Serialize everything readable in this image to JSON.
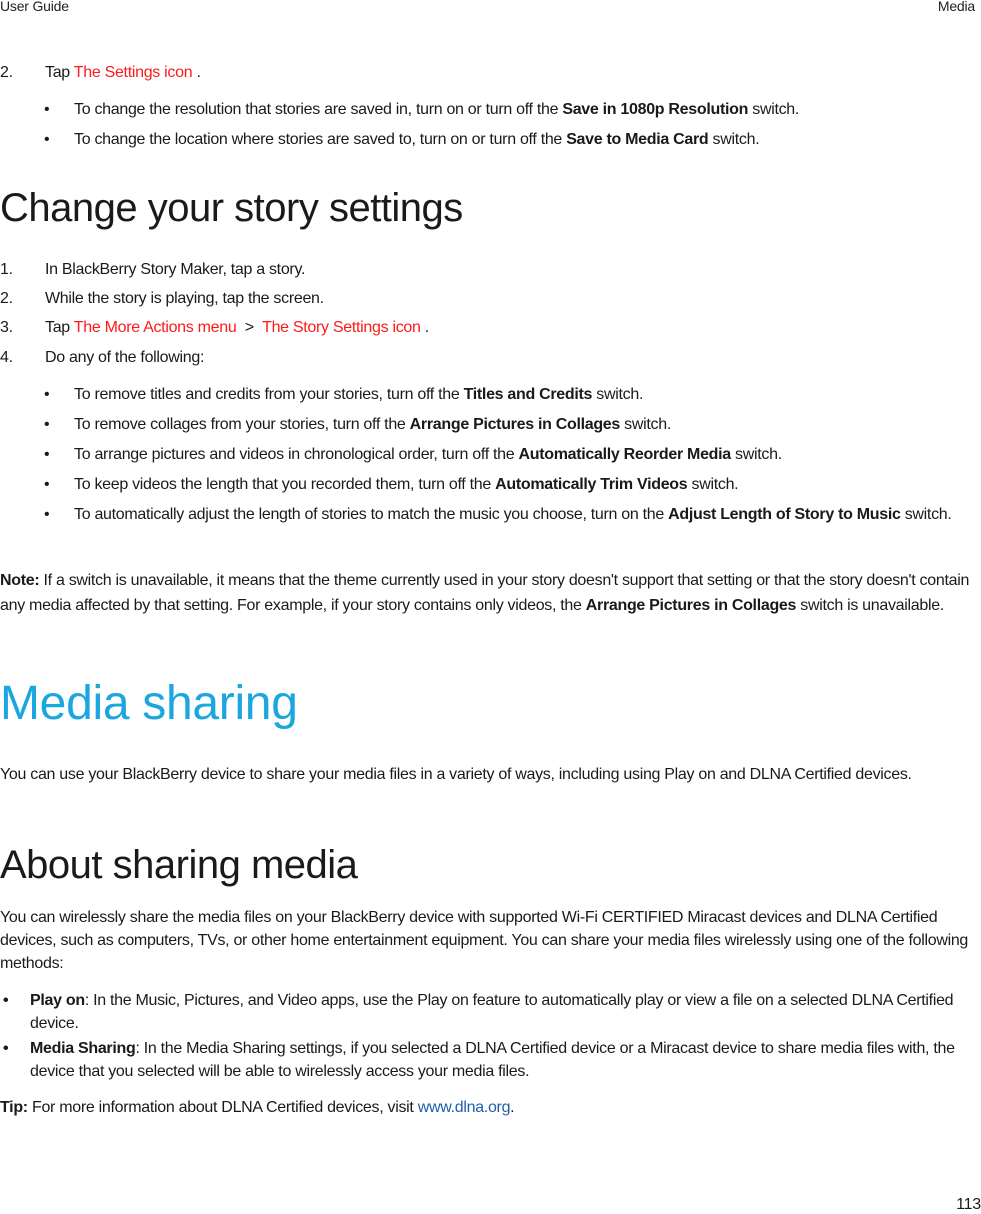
{
  "header": {
    "left": "User Guide",
    "right": "Media"
  },
  "intro_step": {
    "number": "2.",
    "prefix": "Tap ",
    "link": "The Settings icon",
    "suffix": " .",
    "bullets": [
      {
        "before": "To change the resolution that stories are saved in, turn on or turn off the ",
        "bold": "Save in 1080p Resolution",
        "after": " switch."
      },
      {
        "before": "To change the location where stories are saved to, turn on or turn off the ",
        "bold": "Save to Media Card",
        "after": " switch."
      }
    ]
  },
  "section_story_settings": {
    "title": "Change your story settings",
    "steps": [
      {
        "number": "1.",
        "text": "In BlackBerry Story Maker, tap a story."
      },
      {
        "number": "2.",
        "text": "While the story is playing, tap the screen."
      },
      {
        "number": "3.",
        "prefix": "Tap ",
        "link1": "The More Actions menu",
        "separator": " > ",
        "link2": "The Story Settings icon",
        "suffix": " ."
      },
      {
        "number": "4.",
        "text": "Do any of the following:"
      }
    ],
    "bullets": [
      {
        "before": "To remove titles and credits from your stories, turn off the ",
        "bold": "Titles and Credits",
        "after": " switch."
      },
      {
        "before": "To remove collages from your stories, turn off the ",
        "bold": "Arrange Pictures in Collages",
        "after": " switch."
      },
      {
        "before": "To arrange pictures and videos in chronological order, turn off the ",
        "bold": "Automatically Reorder Media",
        "after": " switch."
      },
      {
        "before": "To keep videos the length that you recorded them, turn off the ",
        "bold": "Automatically Trim Videos",
        "after": " switch."
      },
      {
        "before": "To automatically adjust the length of stories to match the music you choose, turn on the ",
        "bold": "Adjust Length of Story to Music",
        "after": " switch."
      }
    ],
    "note": {
      "label": "Note:",
      "text1": " If a switch is unavailable, it means that the theme currently used in your story doesn't support that setting or that the story doesn't contain any media affected by that setting. For example, if your story contains only videos, the ",
      "bold": "Arrange Pictures in Collages",
      "text2": " switch is unavailable."
    }
  },
  "section_media_sharing": {
    "title": "Media sharing",
    "intro": "You can use your BlackBerry device to share your media files in a variety of ways, including using Play on and DLNA Certified devices."
  },
  "section_about_sharing": {
    "title": "About sharing media",
    "intro": "You can wirelessly share the media files on your BlackBerry device with supported Wi-Fi CERTIFIED Miracast devices and DLNA Certified devices, such as computers, TVs, or other home entertainment equipment. You can share your media files wirelessly using one of the following methods:",
    "bullets": [
      {
        "bold": "Play on",
        "text": ": In the Music, Pictures, and Video apps, use the Play on feature to automatically play or view a file on a selected DLNA Certified device."
      },
      {
        "bold": "Media Sharing",
        "text": ": In the Media Sharing settings, if you selected a DLNA Certified device or a Miracast device to share media files with, the device that you selected will be able to wirelessly access your media files."
      }
    ],
    "tip": {
      "label": "Tip:",
      "text": " For more information about DLNA Certified devices, visit ",
      "link": "www.dlna.org",
      "after": "."
    }
  },
  "footer": {
    "page_number": "113"
  },
  "colors": {
    "ui_link_red": "#ff1a1a",
    "heading_blue": "#1ba6e0",
    "web_link_blue": "#1f5fa8"
  }
}
